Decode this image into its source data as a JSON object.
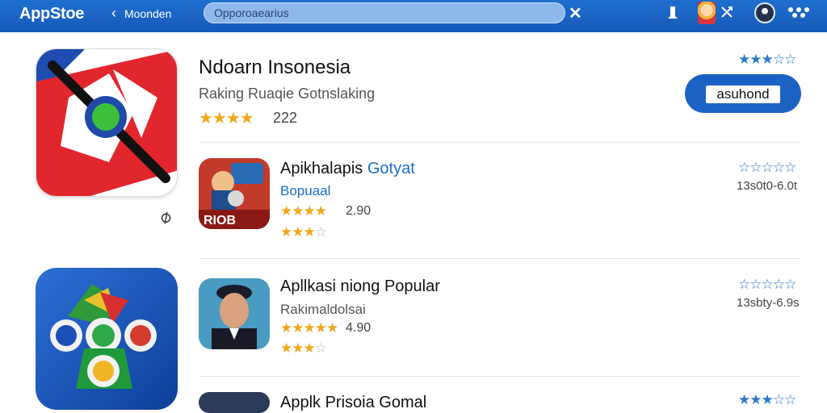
{
  "topbar": {
    "app_name": "AppStoe",
    "back_label": "Moonden",
    "search_value": "Opporoaearius",
    "colors": {
      "bar": "#1a63c4",
      "accent": "#1c62c4"
    }
  },
  "featured": {
    "title": "Ndoarn Insonesia",
    "subtitle": "Raking Ruaqie Gotnslaking",
    "stars": "★★★★",
    "rating_count": "222",
    "top_stars": "★★★☆☆",
    "button_label": "asuhond"
  },
  "rows": [
    {
      "title": "Apikhalapis",
      "title_accent": "Gotyat",
      "subtitle": "Bopuaal",
      "stars": "★★★★",
      "value": "2.90",
      "stars2": "★★★",
      "stars2_empty": "☆",
      "right_stars": "☆☆☆☆☆",
      "right_value": "13s0t0-6.0t",
      "poster_text": "RIOB"
    },
    {
      "title": "Apllkasi niong Popular",
      "subtitle": "Rakimaldolsai",
      "stars": "★★★★★",
      "value": "4.90",
      "stars2": "★★★",
      "stars2_empty": "☆",
      "right_stars": "☆☆☆☆☆",
      "right_value": "13sbty-6.9s"
    },
    {
      "title": "Applk Prisoia Gomal",
      "right_stars": "★★★☆☆"
    }
  ]
}
